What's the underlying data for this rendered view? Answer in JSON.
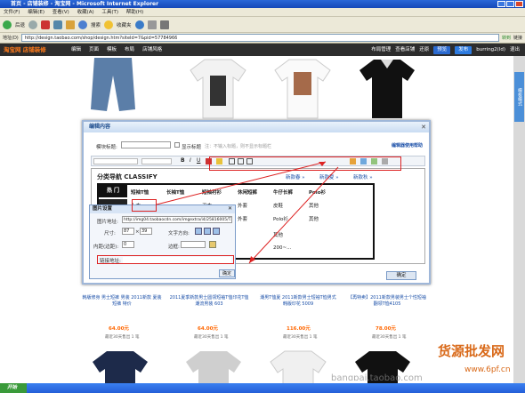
{
  "window": {
    "title": "首页 - 店铺装修 - 淘宝网 - Microsoft Internet Explorer"
  },
  "menu": [
    "文件(F)",
    "编辑(E)",
    "查看(V)",
    "收藏(A)",
    "工具(T)",
    "帮助(H)"
  ],
  "toolbar": {
    "back": "后退",
    "search": "搜索",
    "favorites": "收藏夹"
  },
  "address": {
    "label": "地址(D)",
    "url": "http://design.taobao.com/shop/design.htm?siteId=7&pid=57784966",
    "go": "转到",
    "links": "链接"
  },
  "taobao": {
    "logo": "淘宝网 店铺装修",
    "nav": [
      "编辑",
      "页面",
      "模板",
      "布局",
      "店铺风格"
    ],
    "right": [
      "布局管理",
      "查看店铺",
      "还原",
      "预览",
      "发布",
      "burring2(ld)",
      "退出"
    ]
  },
  "sidetab": "模板模式",
  "products": [
    {
      "title": "韩版修身 男士短裤 男装 2011新款 夏装短裤 特价",
      "price": "64.00元",
      "sales": "最近30天售出 1 笔"
    },
    {
      "title": "2011夏季新款男士圆领短袖T恤印花T恤 潮流男装 603",
      "price": "64.00元",
      "sales": "最近30天售出 1 笔"
    },
    {
      "title": "潮男T恤夏 2011新款男士短袖T恤男式 韩版印花 5009",
      "price": "116.00元",
      "sales": "最近30天售出 1 笔"
    },
    {
      "title": "【再特卖】2011新款男装男士个性短袖翻领T恤4105",
      "price": "78.00元",
      "sales": "最近30天售出 1 笔"
    }
  ],
  "dialog": {
    "title": "编辑内容",
    "module_title_label": "模块标题:",
    "show_title": "显示标题",
    "hint": "注：不输入标题，则不显示标题栏",
    "help": "编辑器使用帮助",
    "section_title": "分类导航 CLASSIFY",
    "links": [
      "新款春 »",
      "新款夏 »",
      "新款秋 »"
    ],
    "categories_row1": [
      "热 门",
      "短袖T恤",
      "长袖T恤",
      "短袖衬衫",
      "休闲短裤",
      "牛仔长裤",
      "Polo衫"
    ],
    "categories_row2": [
      "上衣",
      "卫衣",
      "外套",
      "皮鞋",
      "其他"
    ],
    "categories_row3": [
      "外套",
      "Polo衫",
      "其他"
    ],
    "categories_row4": [
      "其他"
    ],
    "categories_row5": [
      "200~..."
    ],
    "confirm": "确定"
  },
  "popup": {
    "title": "图片设置",
    "img_url_label": "图片地址:",
    "img_url": "http://img04.taobaocdn.com/imgextra/i4/25816005/T2",
    "size_label": "尺寸:",
    "width": "87",
    "height": "39",
    "align_label": "文字方向:",
    "margin_label": "内距(边距):",
    "margin_val": "0",
    "border_label": "边框:",
    "link_label": "链接地址:",
    "ok": "确定"
  },
  "watermark": {
    "text1": "货源批发网",
    "text2": "www.6pf.cn",
    "text3": "bangpai.taobao.com"
  },
  "taskbar": {
    "start": "开始"
  }
}
